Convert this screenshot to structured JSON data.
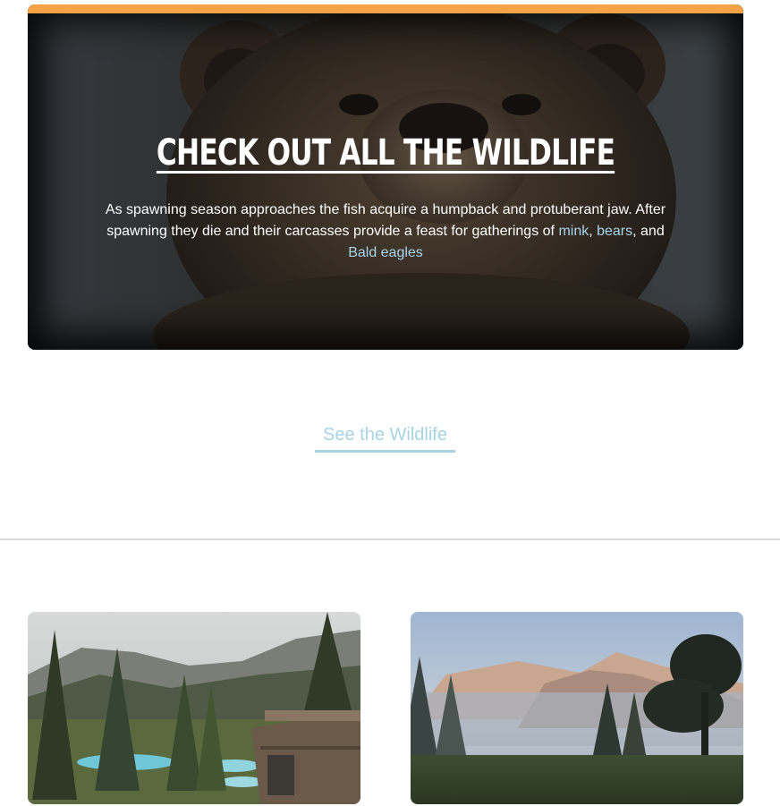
{
  "hero": {
    "title": "CHECK OUT ALL THE WILDLIFE",
    "text_before": "As spawning season approaches the fish acquire a humpback and protuberant jaw. After spawning they die and their carcasses provide a feast for gatherings of ",
    "link_mink": "mink",
    "sep1": ", ",
    "link_bears": "bears",
    "sep2": ", and ",
    "link_eagles": "Bald eagles",
    "accent_color": "#f6a347",
    "link_color": "#a9d4ec"
  },
  "cta": {
    "label": "See the Wildlife",
    "color": "#a6d4e3"
  },
  "cards": [
    {
      "image": "resort-pool-forest-photo"
    },
    {
      "image": "misty-mountain-meadow-photo"
    }
  ]
}
